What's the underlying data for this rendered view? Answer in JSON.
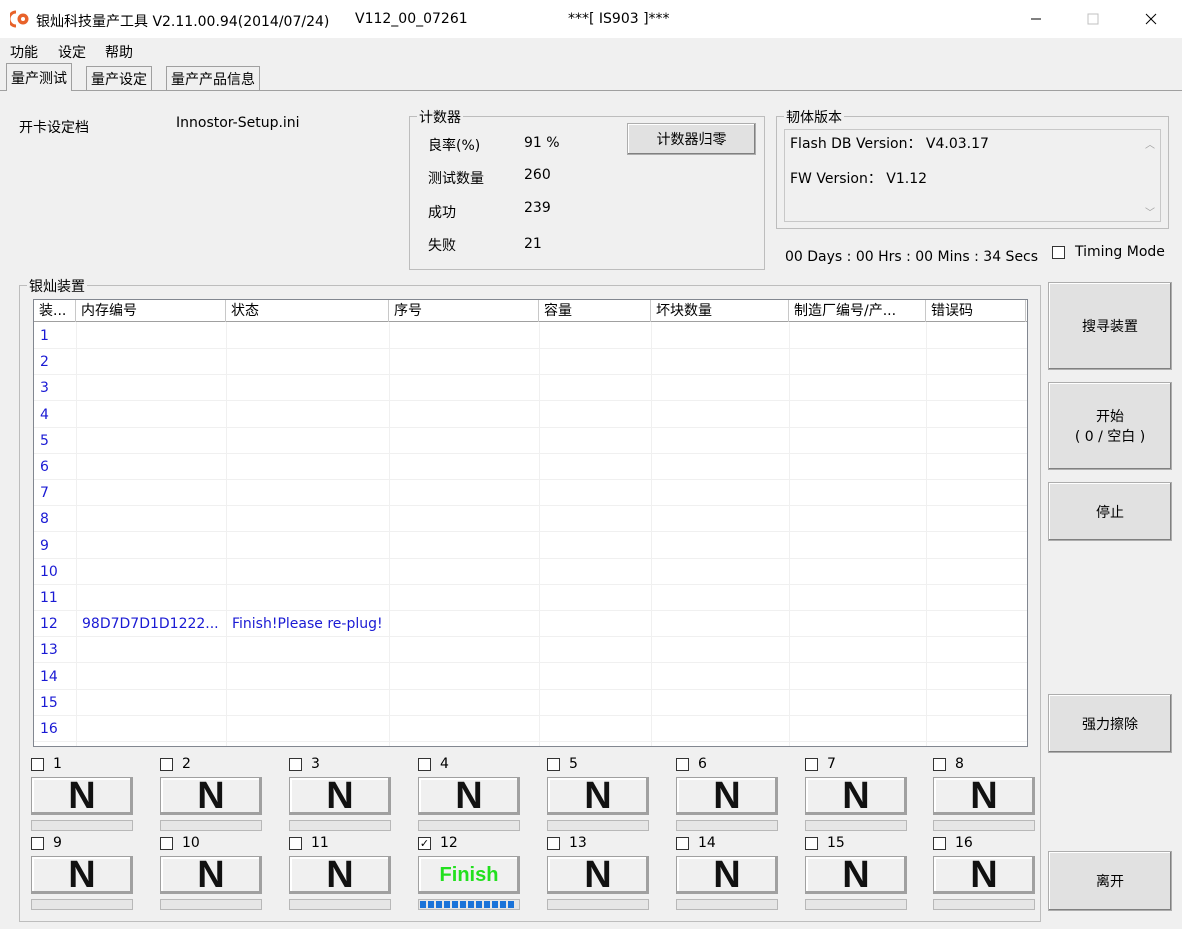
{
  "window": {
    "title": "银灿科技量产工具 V2.11.00.94(2014/07/24)",
    "version": "V112_00_07261",
    "ic": "***[ IS903 ]***"
  },
  "menu": [
    "功能",
    "设定",
    "帮助"
  ],
  "tabs": [
    "量产测试",
    "量产设定",
    "量产产品信息"
  ],
  "setup": {
    "label": "开卡设定档",
    "file": "Innostor-Setup.ini"
  },
  "counter": {
    "group_label": "计数器",
    "reset_label": "计数器归零",
    "rows": [
      {
        "label": "良率(%)",
        "value": "91 %"
      },
      {
        "label": "测试数量",
        "value": "260"
      },
      {
        "label": "成功",
        "value": "239"
      },
      {
        "label": "失败",
        "value": "21"
      }
    ]
  },
  "firmware": {
    "group_label": "韧体版本",
    "flash_db": "Flash DB Version： V4.03.17",
    "fw": "FW Version： V1.12"
  },
  "timer": "00 Days : 00 Hrs : 00 Mins : 34 Secs",
  "timing_mode": "Timing Mode",
  "devices": {
    "group_label": "银灿装置",
    "columns": [
      "装...",
      "内存编号",
      "状态",
      "序号",
      "容量",
      "坏块数量",
      "制造厂编号/产...",
      "错误码"
    ],
    "rows": [
      [
        "1",
        "",
        "",
        "",
        "",
        "",
        "",
        ""
      ],
      [
        "2",
        "",
        "",
        "",
        "",
        "",
        "",
        ""
      ],
      [
        "3",
        "",
        "",
        "",
        "",
        "",
        "",
        ""
      ],
      [
        "4",
        "",
        "",
        "",
        "",
        "",
        "",
        ""
      ],
      [
        "5",
        "",
        "",
        "",
        "",
        "",
        "",
        ""
      ],
      [
        "6",
        "",
        "",
        "",
        "",
        "",
        "",
        ""
      ],
      [
        "7",
        "",
        "",
        "",
        "",
        "",
        "",
        ""
      ],
      [
        "8",
        "",
        "",
        "",
        "",
        "",
        "",
        ""
      ],
      [
        "9",
        "",
        "",
        "",
        "",
        "",
        "",
        ""
      ],
      [
        "10",
        "",
        "",
        "",
        "",
        "",
        "",
        ""
      ],
      [
        "11",
        "",
        "",
        "",
        "",
        "",
        "",
        ""
      ],
      [
        "12",
        "98D7D7D1D1222...",
        "Finish!Please re-plug!",
        "",
        "",
        "",
        "",
        ""
      ],
      [
        "13",
        "",
        "",
        "",
        "",
        "",
        "",
        ""
      ],
      [
        "14",
        "",
        "",
        "",
        "",
        "",
        "",
        ""
      ],
      [
        "15",
        "",
        "",
        "",
        "",
        "",
        "",
        ""
      ],
      [
        "16",
        "",
        "",
        "",
        "",
        "",
        "",
        ""
      ]
    ]
  },
  "slots": [
    {
      "num": "1",
      "state": "N",
      "checked": false,
      "progress": 0
    },
    {
      "num": "2",
      "state": "N",
      "checked": false,
      "progress": 0
    },
    {
      "num": "3",
      "state": "N",
      "checked": false,
      "progress": 0
    },
    {
      "num": "4",
      "state": "N",
      "checked": false,
      "progress": 0
    },
    {
      "num": "5",
      "state": "N",
      "checked": false,
      "progress": 0
    },
    {
      "num": "6",
      "state": "N",
      "checked": false,
      "progress": 0
    },
    {
      "num": "7",
      "state": "N",
      "checked": false,
      "progress": 0
    },
    {
      "num": "8",
      "state": "N",
      "checked": false,
      "progress": 0
    },
    {
      "num": "9",
      "state": "N",
      "checked": false,
      "progress": 0
    },
    {
      "num": "10",
      "state": "N",
      "checked": false,
      "progress": 0
    },
    {
      "num": "11",
      "state": "N",
      "checked": false,
      "progress": 0
    },
    {
      "num": "12",
      "state": "Finish",
      "checked": true,
      "progress": 1.0
    },
    {
      "num": "13",
      "state": "N",
      "checked": false,
      "progress": 0
    },
    {
      "num": "14",
      "state": "N",
      "checked": false,
      "progress": 0
    },
    {
      "num": "15",
      "state": "N",
      "checked": false,
      "progress": 0
    },
    {
      "num": "16",
      "state": "N",
      "checked": false,
      "progress": 0
    }
  ],
  "actions": {
    "search": "搜寻装置",
    "start_line1": "开始",
    "start_line2": "( 0 / 空白 )",
    "stop": "停止",
    "erase": "强力擦除",
    "exit": "离开"
  },
  "colors": {
    "table_text": "#1a1ad4",
    "finish_text": "#22e01e",
    "progress": "#1a73d9",
    "icon": "#e8622a"
  }
}
